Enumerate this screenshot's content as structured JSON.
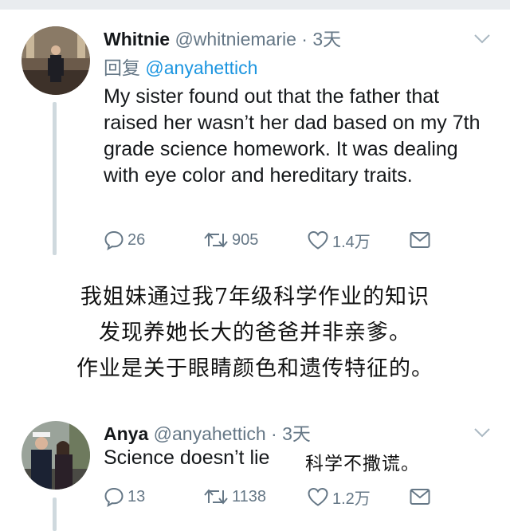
{
  "tweet1": {
    "name": "Whitnie",
    "handle": "@whitniemarie",
    "separator": "·",
    "time": "3天",
    "reply_label": "回复",
    "reply_mention": "@anyahettich",
    "text": "My sister found out that the father that raised her wasn’t her dad based on my 7th grade science homework. It was dealing with eye color and hereditary traits.",
    "actions": {
      "reply_count": "26",
      "retweet_count": "905",
      "like_count": "1.4万"
    }
  },
  "caption": {
    "line1": "我姐妹通过我7年级科学作业的知识",
    "line2": "发现养她长大的爸爸并非亲爹。",
    "line3": "作业是关于眼睛颜色和遗传特征的。"
  },
  "tweet2": {
    "name": "Anya",
    "handle": "@anyahettich",
    "separator": "·",
    "time": "3天",
    "text": "Science doesn’t lie",
    "inline_caption": "科学不撒谎。",
    "actions": {
      "reply_count": "13",
      "retweet_count": "1138",
      "like_count": "1.2万"
    }
  },
  "colors": {
    "text": "#14171a",
    "secondary": "#657786",
    "link": "#1b95e0",
    "thread_line": "#cfd9de"
  },
  "icons": [
    "reply-icon",
    "retweet-icon",
    "like-icon",
    "share-icon",
    "chevron-down-icon"
  ]
}
